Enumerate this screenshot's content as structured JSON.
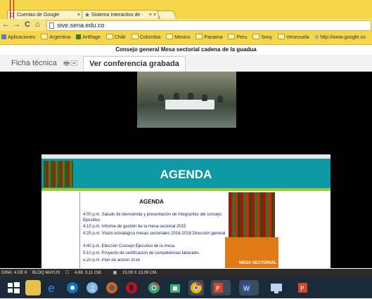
{
  "browser": {
    "tabs": [
      {
        "label": "Cuentas de Google",
        "close": "×"
      },
      {
        "label": "Sistema Interactivo de ·",
        "close": "× ×"
      }
    ],
    "nav": {
      "back": "←",
      "forward": "→",
      "reload": "C",
      "home": "⌂",
      "url": "sive.sena.edu.co"
    },
    "bookmarks": [
      "Aplicaciones",
      "Argentina",
      "ArtRage",
      "Chile",
      "Colombia",
      "Mexico",
      "Panama",
      "Peru",
      "Sony",
      "Venezuela",
      "http://www.google.co"
    ]
  },
  "page": {
    "title": "Consejo general Mesa sectorial cadena de la guadua",
    "tabs": [
      "Ficha técnica",
      "Ver conferencia grabada"
    ],
    "tab_icons": "🖶✉"
  },
  "slide": {
    "header": "AGENDA",
    "subtitle": "AGENDA",
    "items": [
      "4:00 p.m. Saludo de bienvenida y presentación de integrantes del consejo Ejecutivo",
      "4:10 p.m. Informe de gestión de la mesa sectorial 2015",
      "4:25 p.m. Visión estratégica mesas sectoriales 2016-2018 Dirección general.",
      "4:40 p.m. Elección Consejo Ejecutivo de la mesa.",
      "5:10 p.m. Proyecto de certificación de competencias laborales",
      "5:20 p.m. Plan de acción 2016"
    ],
    "corner_text": "MESA SECTORIAL"
  },
  "status": {
    "page": "GINA: 4 DE 6",
    "caps": "BLOQ MAYÚS",
    "pos": "4,68, 3,11 CM.",
    "size": "15,09 X 13,09 CM."
  },
  "taskbar": {
    "icons": [
      "windows-icon",
      "file-explorer-icon",
      "internet-explorer-icon",
      "media-player-icon",
      "itunes-icon",
      "firefox-icon",
      "opera-icon",
      "chrome-icon",
      "store-icon",
      "chrome-icon",
      "powerpoint-icon",
      "word-icon",
      "screen-icon",
      "powerpoint-icon"
    ],
    "labels": {
      "p1": "P",
      "w": "W",
      "p2": "P"
    }
  },
  "colors": {
    "tabbar": "#f6d64a",
    "agenda_bar": "#0f99a6",
    "accent_green": "#9bc93c"
  }
}
